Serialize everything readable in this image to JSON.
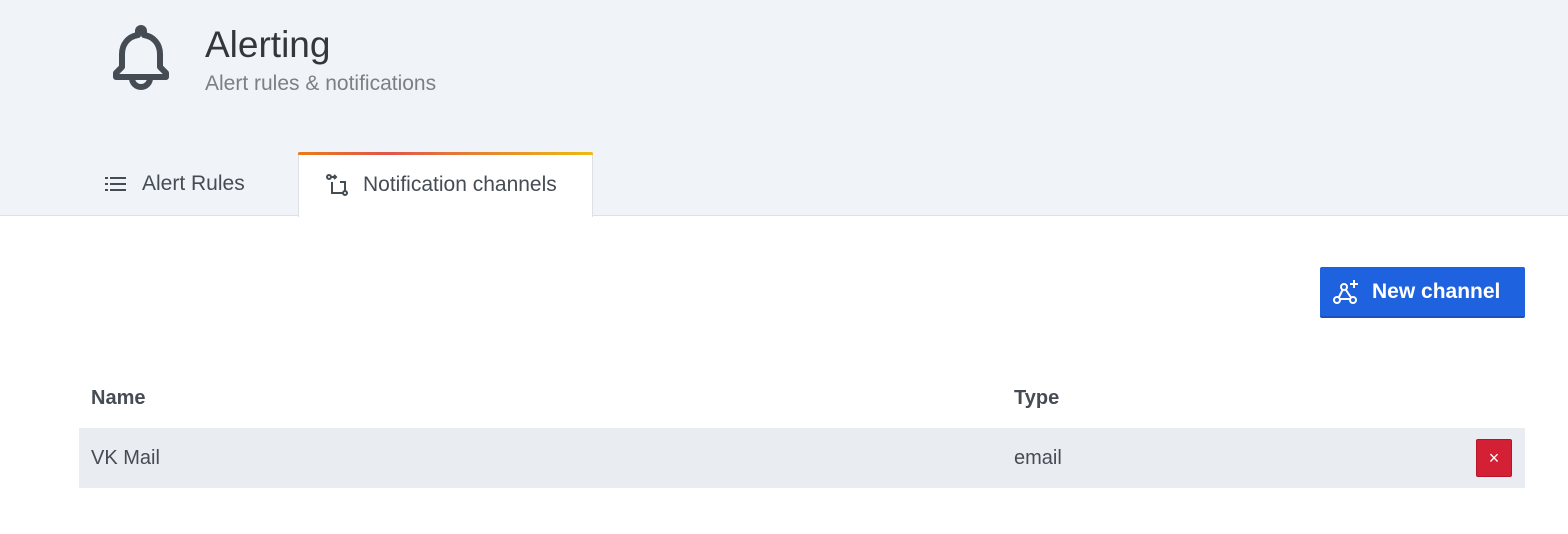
{
  "header": {
    "icon": "bell-icon",
    "title": "Alerting",
    "subtitle": "Alert rules & notifications"
  },
  "tabs": [
    {
      "label": "Alert Rules",
      "icon": "list-icon",
      "active": false
    },
    {
      "label": "Notification channels",
      "icon": "channels-icon",
      "active": true
    }
  ],
  "actions": {
    "new_channel_label": "New channel",
    "new_channel_icon": "new-channel-icon"
  },
  "table": {
    "columns": [
      "Name",
      "Type"
    ],
    "rows": [
      {
        "name": "VK Mail",
        "type": "email",
        "delete_glyph": "×"
      }
    ]
  },
  "colors": {
    "primary": "#1f62e0",
    "danger": "#d42035",
    "tab_accent_start": "#eb7b18",
    "tab_accent_end": "#ecbb13"
  }
}
